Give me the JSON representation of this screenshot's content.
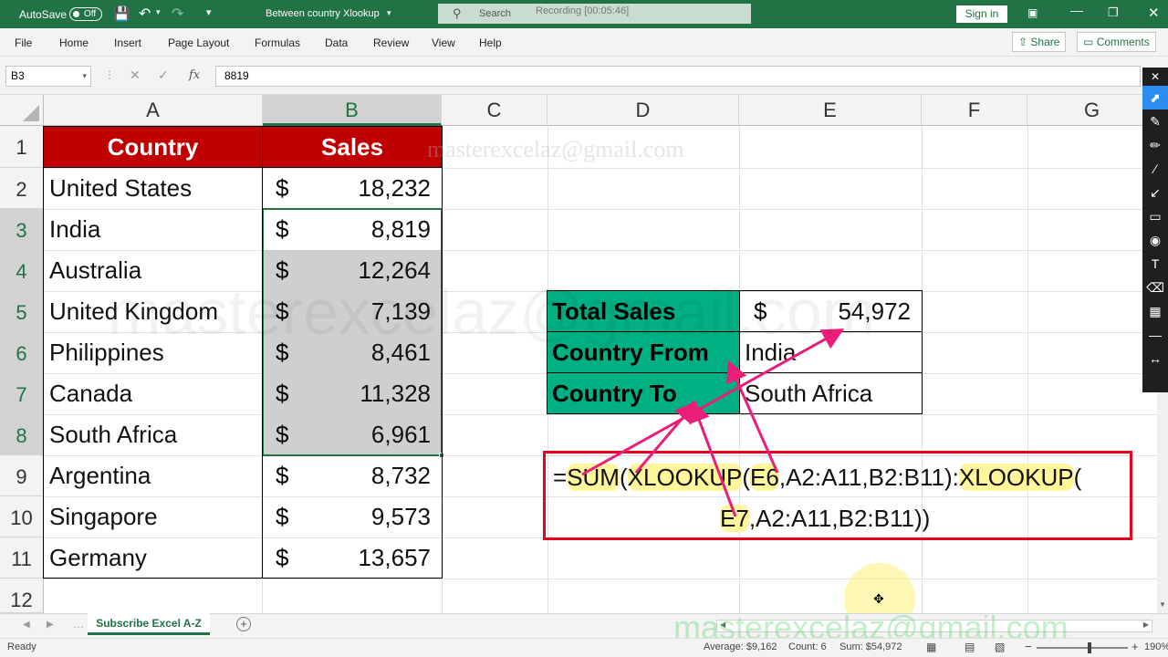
{
  "titlebar": {
    "autosave_label": "AutoSave",
    "autosave_state": "Off",
    "doc_title": "Between country Xlookup",
    "search_placeholder": "Search",
    "recording": "Recording [00:05:46]",
    "signin": "Sign in"
  },
  "menu": {
    "tabs": [
      "File",
      "Home",
      "Insert",
      "Page Layout",
      "Formulas",
      "Data",
      "Review",
      "View",
      "Help"
    ],
    "share": "Share",
    "comments": "Comments"
  },
  "formula_bar": {
    "name_box": "B3",
    "fx": "fx",
    "value": "8819"
  },
  "grid": {
    "columns": [
      "A",
      "B",
      "C",
      "D",
      "E",
      "F",
      "G"
    ],
    "rows": [
      "1",
      "2",
      "3",
      "4",
      "5",
      "6",
      "7",
      "8",
      "9",
      "10",
      "11",
      "12"
    ],
    "header_country": "Country",
    "header_sales": "Sales",
    "currency": "$",
    "data": [
      {
        "country": "United States",
        "sales": "18,232"
      },
      {
        "country": "India",
        "sales": "8,819"
      },
      {
        "country": "Australia",
        "sales": "12,264"
      },
      {
        "country": "United Kingdom",
        "sales": "7,139"
      },
      {
        "country": "Philippines",
        "sales": "8,461"
      },
      {
        "country": "Canada",
        "sales": "11,328"
      },
      {
        "country": "South Africa",
        "sales": "6,961"
      },
      {
        "country": "Argentina",
        "sales": "8,732"
      },
      {
        "country": "Singapore",
        "sales": "9,573"
      },
      {
        "country": "Germany",
        "sales": "13,657"
      }
    ],
    "summary": {
      "total_label": "Total Sales",
      "total_currency": "$",
      "total_value": "54,972",
      "from_label": "Country From",
      "from_value": "India",
      "to_label": "Country To",
      "to_value": "South Africa"
    },
    "formula": {
      "eq": "=",
      "sum": "SUM",
      "p1": "(",
      "xlookup1": "XLOOKUP",
      "p2": "(",
      "e6": "E6",
      "rest1": ",A2:A11,B2:B11):",
      "xlookup2": "XLOOKUP",
      "p3": "(",
      "e7": "E7",
      "rest2": ",A2:A11,B2:B11))"
    },
    "watermark_email": "masterexcelaz@gmail.com",
    "watermark_mid": "masterexcelaz@gmail.com"
  },
  "sheet_tabs": {
    "active": "Subscribe Excel A-Z"
  },
  "status": {
    "ready": "Ready",
    "average": "Average: $9,162",
    "count": "Count: 6",
    "sum": "Sum: $54,972",
    "zoom": "190%"
  },
  "footer_watermark": "masterexcelaz@gmail.com",
  "colors": {
    "excel_green": "#217346",
    "header_red": "#c00000",
    "summary_green": "#00b083",
    "formula_box": "#e8001c",
    "highlight": "#fff59a",
    "arrow_pink": "#ea1e78"
  }
}
